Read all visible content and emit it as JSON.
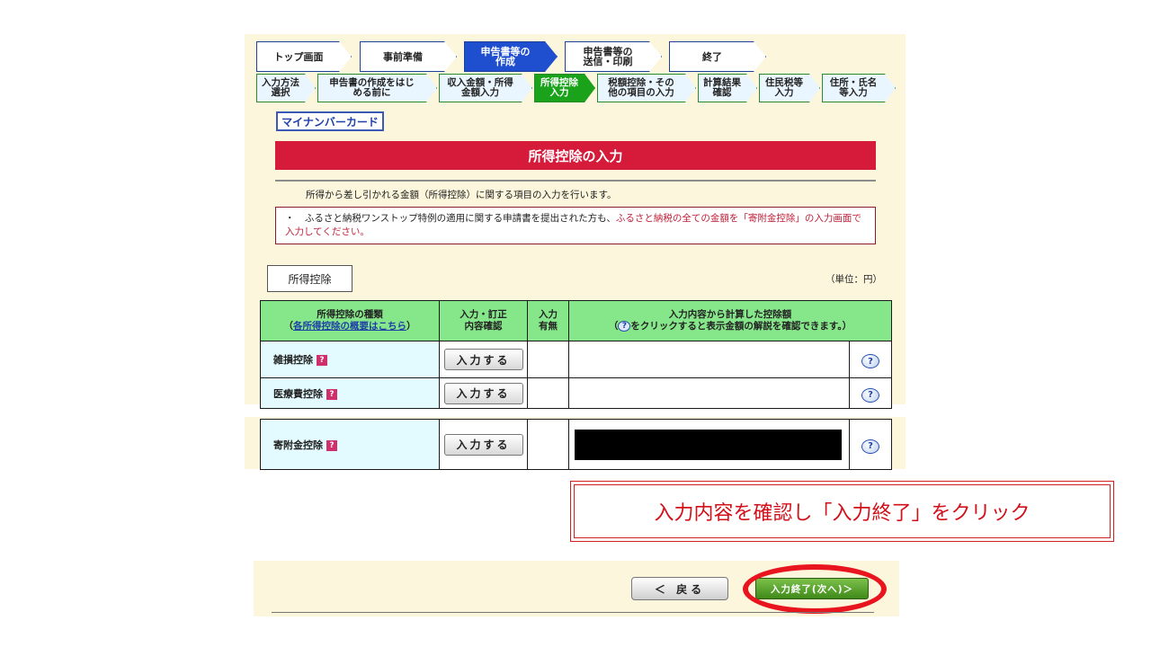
{
  "steps_main": [
    {
      "label": "トップ画面",
      "active": false
    },
    {
      "label": "事前準備",
      "active": false
    },
    {
      "label": "申告書等の\n作成",
      "active": true
    },
    {
      "label": "申告書等の\n送信・印刷",
      "active": false
    },
    {
      "label": "終了",
      "active": false
    }
  ],
  "steps_sub": [
    {
      "label": "入力方法\n選択",
      "active": false
    },
    {
      "label": "申告書の作成をはじ\nめる前に",
      "active": false
    },
    {
      "label": "収入金額・所得\n金額入力",
      "active": false
    },
    {
      "label": "所得控除\n入力",
      "active": true
    },
    {
      "label": "税額控除・その\n他の項目の入力",
      "active": false
    },
    {
      "label": "計算結果\n確認",
      "active": false
    },
    {
      "label": "住民税等\n入力",
      "active": false
    },
    {
      "label": "住所・氏名\n等入力",
      "active": false
    }
  ],
  "mynumber_button": "マイナンバーカード",
  "page_title": "所得控除の入力",
  "intro_text": "所得から差し引かれる金額（所得控除）に関する項目の入力を行います。",
  "notice": {
    "bullet": "・",
    "text_black": "ふるさと納税ワンストップ特例の適用に関する申請書を提出された方も、",
    "text_red": "ふるさと納税の全ての金額を「寄附金控除」の入力画面で入力してください。",
    "text_end": ""
  },
  "section_tab": "所得控除",
  "unit_label": "（単位：円）",
  "table": {
    "col1_title": "所得控除の種類",
    "col1_paren_open": "（",
    "col1_link": "各所得控除の概要はこちら",
    "col1_paren_close": "）",
    "col2_line1": "入力・訂正",
    "col2_line2": "内容確認",
    "col3_line1": "入力",
    "col3_line2": "有無",
    "col4_line1": "入力内容から計算した控除額",
    "col4_line2_before": "（",
    "col4_line2_after": "をクリックすると表示金額の解説を確認できます。）",
    "help_glyph": "?",
    "qmark_glyph": "?",
    "rows": [
      {
        "label": "雑損控除",
        "button": "入力する"
      },
      {
        "label": "医療費控除",
        "button": "入力する"
      }
    ],
    "row_kifu": {
      "label": "寄附金控除",
      "button": "入力する"
    }
  },
  "callout_text": "入力内容を確認し「入力終了」をクリック",
  "back_button": "＜ 戻る",
  "next_button": "入力終了(次へ)＞",
  "colors": {
    "title_bar": "#d51a3a",
    "header_green": "#86e68a",
    "label_cyan": "#e3fbff",
    "callout_red": "#d2101a",
    "next_green": "#3f8a1a"
  }
}
